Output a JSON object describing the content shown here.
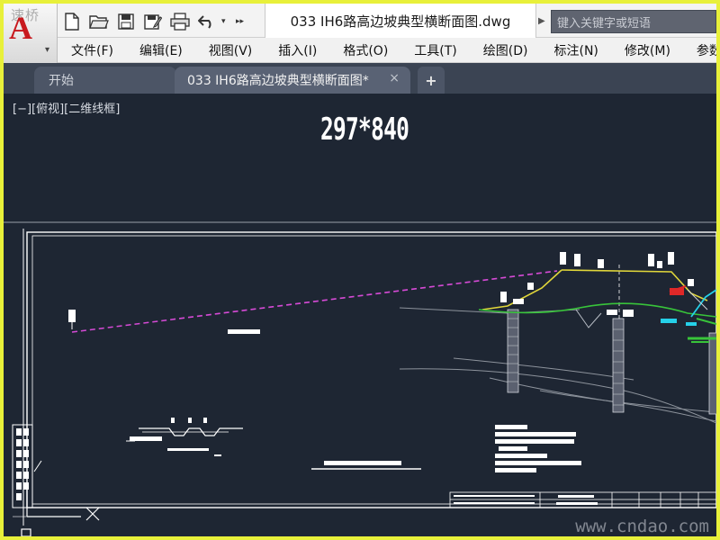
{
  "app": {
    "logo_letter": "A",
    "logo_watermark": "速桥"
  },
  "title_bar": {
    "document_title": "033 IH6路高边坡典型横断面图.dwg",
    "search_placeholder": "键入关键字或短语"
  },
  "quick_access": [
    {
      "icon": "new-file-icon"
    },
    {
      "icon": "open-folder-icon"
    },
    {
      "icon": "save-icon"
    },
    {
      "icon": "save-as-icon"
    },
    {
      "icon": "print-icon"
    },
    {
      "icon": "undo-icon"
    },
    {
      "icon": "dropdown-icon"
    },
    {
      "icon": "more-icon"
    }
  ],
  "menu": [
    {
      "label": "文件(F)"
    },
    {
      "label": "编辑(E)"
    },
    {
      "label": "视图(V)"
    },
    {
      "label": "插入(I)"
    },
    {
      "label": "格式(O)"
    },
    {
      "label": "工具(T)"
    },
    {
      "label": "绘图(D)"
    },
    {
      "label": "标注(N)"
    },
    {
      "label": "修改(M)"
    },
    {
      "label": "参数"
    }
  ],
  "tabs": {
    "start": "开始",
    "document": "033 IH6路高边坡典型横断面图*",
    "close_symbol": "×",
    "add_symbol": "+"
  },
  "canvas": {
    "viewport_label": "[−][俯视][二维线框]",
    "sheet_size": "297*840",
    "watermark": "www.cndao.com"
  },
  "colors": {
    "background": "#1e2633",
    "frame_highlight": "#e8f03a",
    "dashed_line": "#d64ad6",
    "road_line": "#e0d63a",
    "ground_line": "#38c43a",
    "cyan_marks": "#25d0e8",
    "red_marks": "#e02828"
  }
}
